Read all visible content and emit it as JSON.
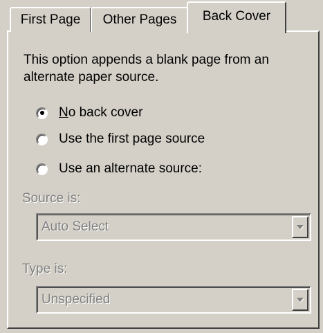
{
  "tabs": [
    {
      "label": "First Page",
      "active": false
    },
    {
      "label": "Other Pages",
      "active": false
    },
    {
      "label": "Back Cover",
      "active": true
    }
  ],
  "description": "This option appends a blank page from an alternate paper source.",
  "options": [
    {
      "label": "No back cover",
      "mnemonic_index": 0,
      "checked": true
    },
    {
      "label": "Use the first page source",
      "checked": false
    },
    {
      "label": "Use an alternate source:",
      "checked": false
    }
  ],
  "source": {
    "label": "Source is:",
    "value": "Auto Select",
    "enabled": false
  },
  "type": {
    "label": "Type is:",
    "value": "Unspecified",
    "enabled": false
  },
  "colors": {
    "face": "#d4d0c8",
    "disabled_text": "#808080",
    "highlight": "#ffffff",
    "shadow": "#808080",
    "dark_shadow": "#404040"
  }
}
